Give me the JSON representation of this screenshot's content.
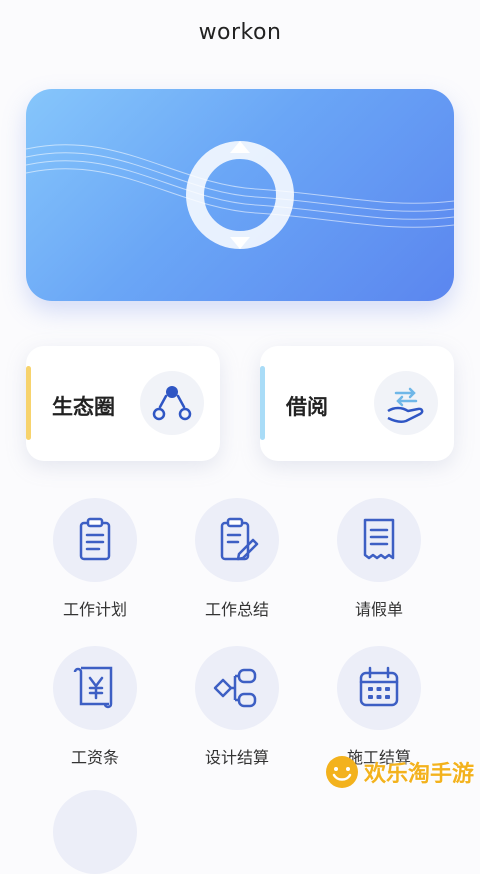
{
  "app": {
    "title": "workon"
  },
  "cards": [
    {
      "label": "生态圈",
      "accent": "#f7d36d",
      "icon": "network-icon"
    },
    {
      "label": "借阅",
      "accent": "#a9dcf7",
      "icon": "hand-exchange-icon"
    }
  ],
  "grid": [
    {
      "label": "工作计划",
      "icon": "clipboard-icon"
    },
    {
      "label": "工作总结",
      "icon": "clipboard-edit-icon"
    },
    {
      "label": "请假单",
      "icon": "receipt-icon"
    },
    {
      "label": "工资条",
      "icon": "yen-scroll-icon"
    },
    {
      "label": "设计结算",
      "icon": "flow-nodes-icon"
    },
    {
      "label": "施工结算",
      "icon": "calendar-icon"
    }
  ],
  "watermark": {
    "text": "欢乐淘手游"
  },
  "colors": {
    "banner_start": "#86c6fb",
    "banner_end": "#5b86ef",
    "icon_blue": "#3d5fc4",
    "icon_bg": "#eceef8"
  }
}
